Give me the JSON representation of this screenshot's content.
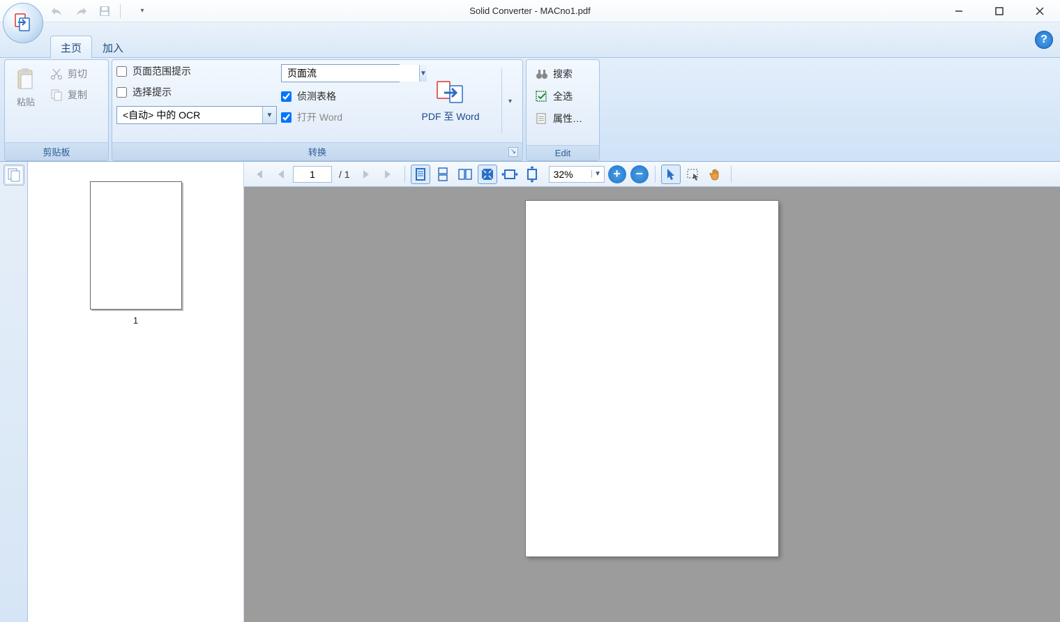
{
  "title": "Solid Converter - MACno1.pdf",
  "qat": {
    "undo": "↶",
    "redo": "↷",
    "save": "💾"
  },
  "tabs": {
    "home": "主页",
    "join": "加入"
  },
  "ribbon": {
    "clipboard": {
      "label": "剪贴板",
      "paste": "粘贴",
      "cut": "剪切",
      "copy": "复制"
    },
    "convert": {
      "label": "转换",
      "page_range_prompt": "页面范围提示",
      "select_prompt": "选择提示",
      "ocr_combo": "<自动> 中的 OCR",
      "flow_combo": "页面流",
      "detect_tables": "侦测表格",
      "open_word": "打开 Word",
      "pdf_to_word": "PDF 至 Word"
    },
    "edit": {
      "label": "Edit",
      "search": "搜索",
      "select_all": "全选",
      "properties": "属性…"
    }
  },
  "viewer": {
    "current_page": "1",
    "total_pages": "/ 1",
    "zoom": "32%",
    "thumb_label": "1"
  }
}
